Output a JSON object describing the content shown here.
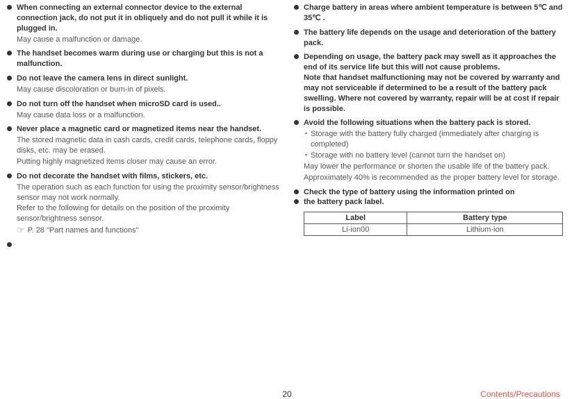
{
  "left": {
    "items": [
      {
        "bold": "When connecting an external connector device to the external connection jack, do not put it in obliquely and do not pull it while it is plugged in.",
        "subs": [
          "May cause a malfunction or damage."
        ]
      },
      {
        "bold": "The handset becomes warm during use or charging but this is not a malfunction."
      },
      {
        "bold": "Do not leave the camera lens in direct sunlight.",
        "subs": [
          "May cause discoloration or burn-in of pixels."
        ]
      },
      {
        "bold": "Do not turn off the handset when microSD card is used..",
        "subs": [
          "May cause data loss or a malfunction."
        ]
      },
      {
        "bold": "Never place a magnetic card or magnetized items near the handset.",
        "subs": [
          "The stored magnetic data in cash cards, credit cards, telephone cards, floppy disks, etc. may be erased.",
          "Putting highly magnetized items closer may cause an error."
        ]
      },
      {
        "bold": "Do not decorate the handset with films, stickers, etc.",
        "subs": [
          "The operation such as each function for using the proximity sensor/brightness sensor may not work normally.",
          "Refer to the following for details on the position of the proximity sensor/brightness sensor."
        ],
        "ref": "P. 28 \"Part  names and functions\""
      },
      {
        "bold": ""
      }
    ]
  },
  "right": {
    "items": [
      {
        "bold": "Charge battery in areas where ambient temperature is between 5℃ and 35℃ ."
      },
      {
        "bold": "The battery life depends on the usage and deterioration of the battery pack."
      },
      {
        "bold": "Depending on usage, the battery pack may swell as it approaches the end of its service life but this will not cause problems.\nNote that handset malfunctioning may not be covered by warranty and may not serviceable if determined to be a result of the battery pack swelling. Where not covered by warranty, repair will be at cost if repair is possible."
      },
      {
        "bold": "Avoid the following situations when the battery pack is stored.",
        "dotted": [
          "Storage with the battery fully charged (immediately after charging is completed)",
          "Storage with no battery level (cannot turn the handset on)"
        ],
        "subs": [
          "May lower the performance or shorten the usable life of the battery pack.",
          "Approximately 40% is recommended as the proper battery level for storage."
        ]
      },
      {
        "bold": "Check the type of battery using the information printed on"
      },
      {
        "bold": "the battery pack label."
      }
    ],
    "table": {
      "headers": [
        "Label",
        "Battery type"
      ],
      "row": [
        "Li-ion00",
        "Lithium-ion"
      ]
    }
  },
  "footer": {
    "page": "20",
    "section": "Contents/Precautions"
  }
}
